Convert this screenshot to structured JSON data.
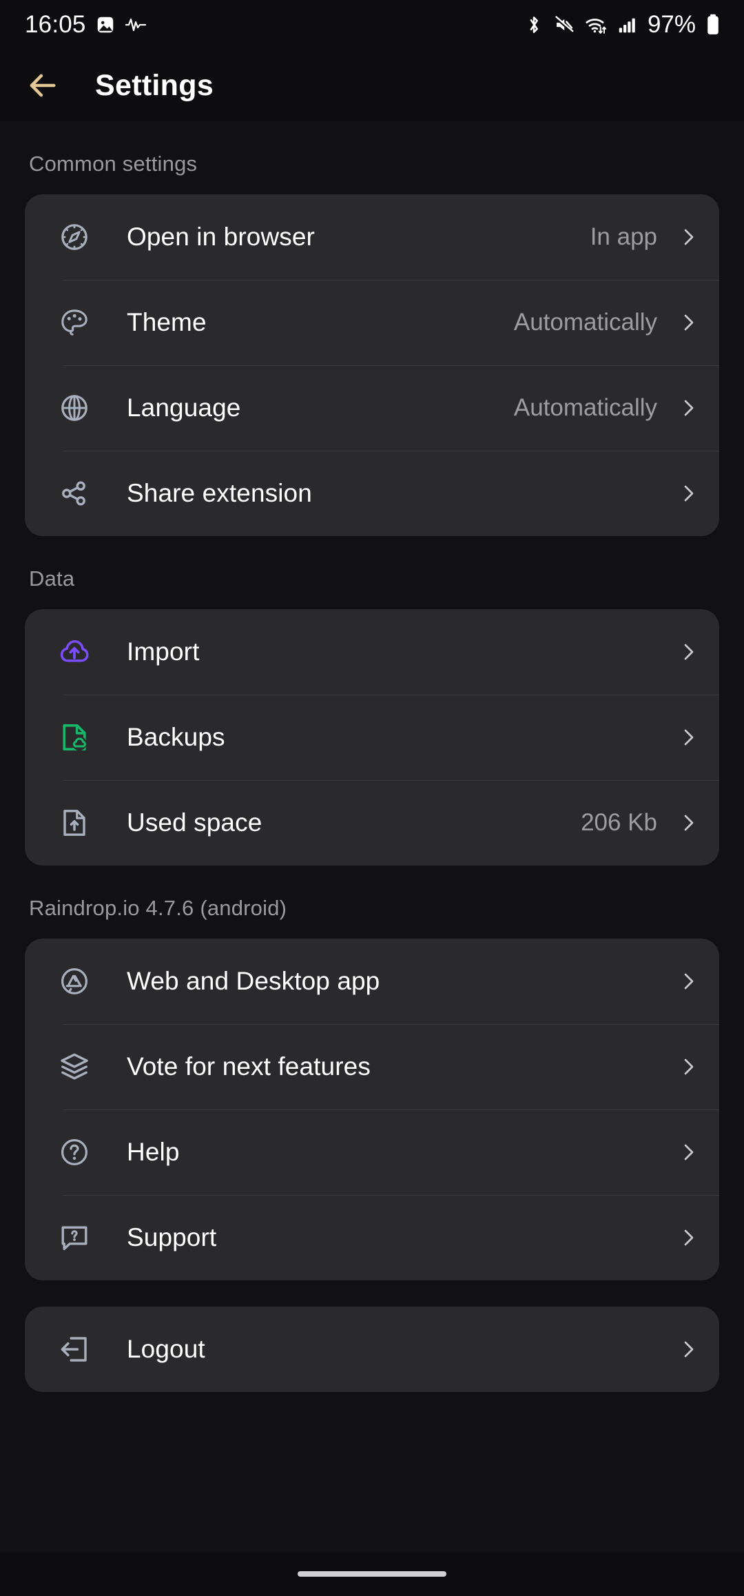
{
  "statusbar": {
    "time": "16:05",
    "battery_percent": "97%",
    "left_icons": [
      "image-icon",
      "activity-waveform-icon"
    ],
    "right_icons": [
      "bluetooth-icon",
      "volume-muted-icon",
      "wifi-icon",
      "cellular-signal-icon",
      "battery-icon"
    ]
  },
  "header": {
    "back_icon": "arrow-left-icon",
    "back_icon_color": "#e3c896",
    "title": "Settings"
  },
  "sections": [
    {
      "label": "Common settings",
      "rows": [
        {
          "icon": "compass-icon",
          "label": "Open in browser",
          "value": "In app"
        },
        {
          "icon": "palette-icon",
          "label": "Theme",
          "value": "Automatically"
        },
        {
          "icon": "globe-icon",
          "label": "Language",
          "value": "Automatically"
        },
        {
          "icon": "share-icon",
          "label": "Share extension",
          "value": ""
        }
      ]
    },
    {
      "label": "Data",
      "rows": [
        {
          "icon": "cloud-upload-icon",
          "label": "Import",
          "value": "",
          "icon_color": "#7c4dff"
        },
        {
          "icon": "file-cloud-icon",
          "label": "Backups",
          "value": "",
          "icon_color": "#17b86a"
        },
        {
          "icon": "file-upload-icon",
          "label": "Used space",
          "value": "206 Kb"
        }
      ]
    },
    {
      "label": "Raindrop.io 4.7.6 (android)",
      "rows": [
        {
          "icon": "app-store-icon",
          "label": "Web and Desktop app",
          "value": ""
        },
        {
          "icon": "layers-icon",
          "label": "Vote for next features",
          "value": ""
        },
        {
          "icon": "question-circle-icon",
          "label": "Help",
          "value": ""
        },
        {
          "icon": "chat-question-icon",
          "label": "Support",
          "value": ""
        }
      ]
    },
    {
      "label": "",
      "rows": [
        {
          "icon": "logout-icon",
          "label": "Logout",
          "value": ""
        }
      ]
    }
  ],
  "colors": {
    "background": "#111113",
    "card": "#2a2a2d",
    "divider": "#3b3b3f",
    "icon_default": "#a9b0bd",
    "label_text": "#ffffff",
    "value_text": "#9d9da1",
    "section_text": "#9a9a9e",
    "accent": "#e3c896",
    "import_purple": "#7c4dff",
    "backup_green": "#17b86a"
  },
  "navbar": {
    "pill": "home-indicator"
  }
}
